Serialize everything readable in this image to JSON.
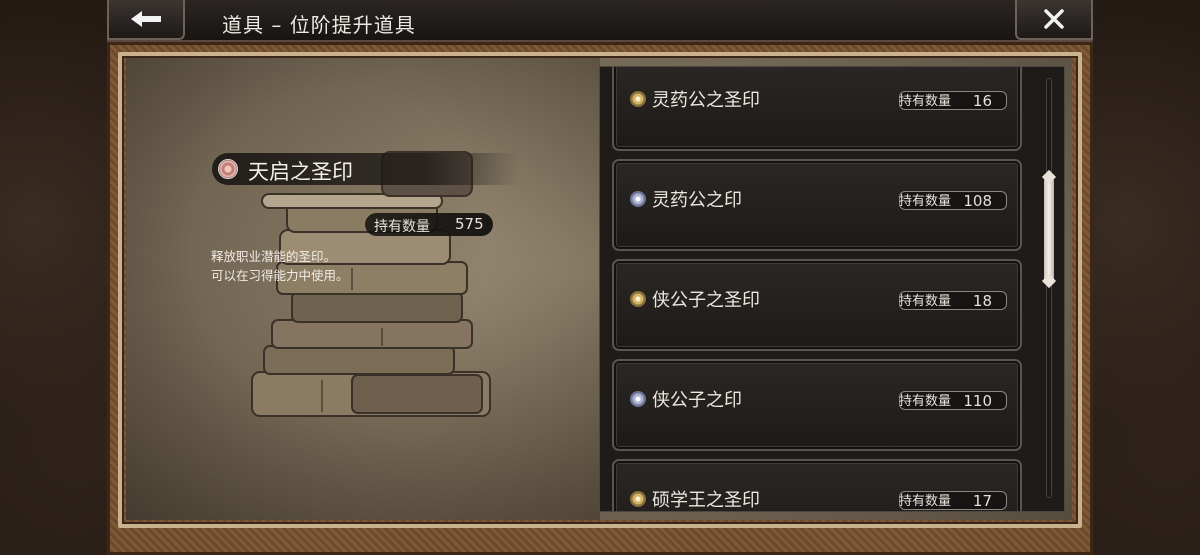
{
  "header": {
    "title": "道具 – 位阶提升道具",
    "back_icon": "arrow-left-icon",
    "close_icon": "close-icon"
  },
  "detail": {
    "name": "天启之圣印",
    "qty_label": "持有数量",
    "qty_value": "575",
    "description_line1": "释放职业潜能的圣印。",
    "description_line2": "可以在习得能力中使用。"
  },
  "items": [
    {
      "name": "灵药公之圣印",
      "icon": "gold",
      "qty_label": "持有数量",
      "qty": "16"
    },
    {
      "name": "灵药公之印",
      "icon": "silver",
      "qty_label": "持有数量",
      "qty": "108"
    },
    {
      "name": "侠公子之圣印",
      "icon": "gold",
      "qty_label": "持有数量",
      "qty": "18"
    },
    {
      "name": "侠公子之印",
      "icon": "silver",
      "qty_label": "持有数量",
      "qty": "110"
    },
    {
      "name": "硕学王之圣印",
      "icon": "gold",
      "qty_label": "持有数量",
      "qty": "17"
    }
  ],
  "colors": {
    "frame_wood": "#6e4a2c",
    "parchment": "#9a8d76",
    "panel_bg": "#1e1b19"
  }
}
